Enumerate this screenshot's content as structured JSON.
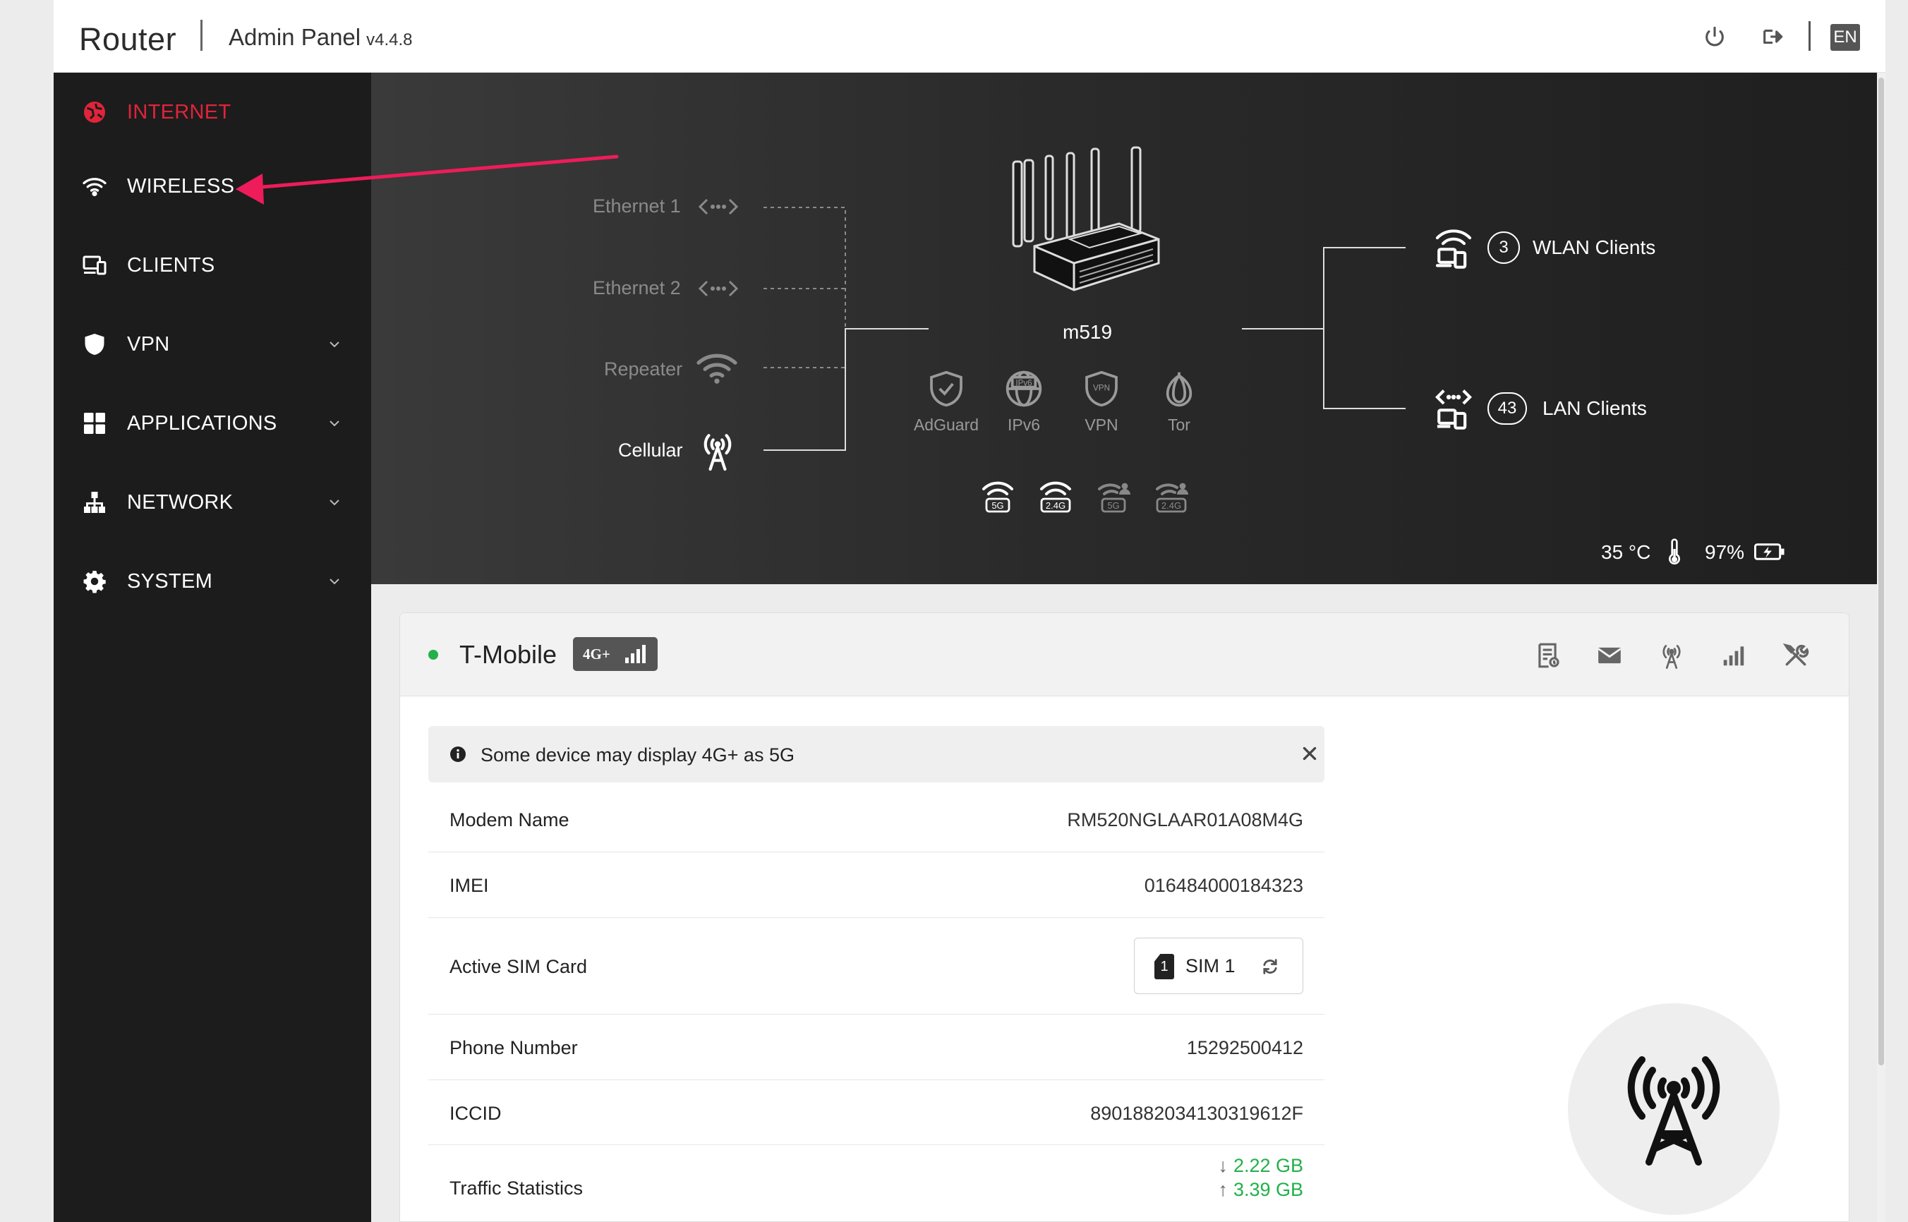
{
  "header": {
    "brand": "Router",
    "panel_title": "Admin Panel",
    "version": "v4.4.8",
    "icons": [
      "power-icon",
      "logout-icon"
    ],
    "language": "EN"
  },
  "sidebar": {
    "items": [
      {
        "label": "INTERNET",
        "icon": "globe-icon",
        "active": true,
        "expandable": false
      },
      {
        "label": "WIRELESS",
        "icon": "wifi-icon",
        "active": false,
        "expandable": false
      },
      {
        "label": "CLIENTS",
        "icon": "devices-icon",
        "active": false,
        "expandable": false
      },
      {
        "label": "VPN",
        "icon": "shield-icon",
        "active": false,
        "expandable": true
      },
      {
        "label": "APPLICATIONS",
        "icon": "apps-grid-icon",
        "active": false,
        "expandable": true
      },
      {
        "label": "NETWORK",
        "icon": "network-tree-icon",
        "active": false,
        "expandable": true
      },
      {
        "label": "SYSTEM",
        "icon": "gear-icon",
        "active": false,
        "expandable": true
      }
    ]
  },
  "topology": {
    "sources": [
      {
        "label": "Ethernet 1",
        "icon": "ethernet-icon",
        "active": false
      },
      {
        "label": "Ethernet 2",
        "icon": "ethernet-icon",
        "active": false
      },
      {
        "label": "Repeater",
        "icon": "wifi-icon",
        "active": false
      },
      {
        "label": "Cellular",
        "icon": "cellular-tower-icon",
        "active": true
      }
    ],
    "device_name": "m519",
    "features": [
      {
        "label": "AdGuard",
        "icon": "adguard-shield-icon"
      },
      {
        "label": "IPv6",
        "icon": "ipv6-globe-icon"
      },
      {
        "label": "VPN",
        "icon": "vpn-shield-icon"
      },
      {
        "label": "Tor",
        "icon": "tor-onion-icon"
      }
    ],
    "radios": [
      {
        "band": "5G",
        "type": "main",
        "enabled": true
      },
      {
        "band": "2.4G",
        "type": "main",
        "enabled": true
      },
      {
        "band": "5G",
        "type": "guest",
        "enabled": false
      },
      {
        "band": "2.4G",
        "type": "guest",
        "enabled": false
      }
    ],
    "clients": {
      "wlan": {
        "count": "3",
        "label": "WLAN Clients"
      },
      "lan": {
        "count": "43",
        "label": "LAN Clients"
      }
    },
    "temperature": "35 °C",
    "battery": "97%"
  },
  "cellular_card": {
    "carrier": "T-Mobile",
    "network_type": "4G+",
    "status_color": "#22b04a",
    "toolbar_icons": [
      "sms-log-icon",
      "mail-icon",
      "cellular-tower-icon",
      "signal-bars-icon",
      "tools-icon"
    ],
    "notice": "Some device may display 4G+ as 5G",
    "rows": {
      "modem_name": {
        "key": "Modem Name",
        "value": "RM520NGLAAR01A08M4G"
      },
      "imei": {
        "key": "IMEI",
        "value": "016484000184323"
      },
      "active_sim": {
        "key": "Active SIM Card",
        "sim_number": "1",
        "value": "SIM 1"
      },
      "phone": {
        "key": "Phone Number",
        "value": "15292500412"
      },
      "iccid": {
        "key": "ICCID",
        "value": "8901882034130319612F"
      },
      "traffic": {
        "key": "Traffic Statistics",
        "download": "2.22 GB",
        "upload": "3.39 GB"
      }
    }
  },
  "colors": {
    "accent_red": "#e0243a",
    "online_green": "#22b04a",
    "sidebar_bg": "#1c1c1c"
  }
}
